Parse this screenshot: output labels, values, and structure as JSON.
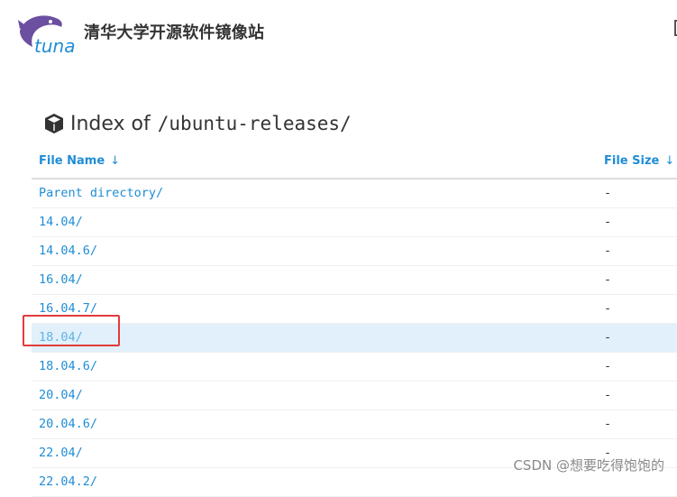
{
  "header": {
    "logo_text": "tuna",
    "site_title": "清华大学开源软件镜像站"
  },
  "index": {
    "prefix": "Index of",
    "path": "/ubuntu-releases/"
  },
  "table": {
    "columns": [
      {
        "label": "File Name",
        "sort_arrow": "↓"
      },
      {
        "label": "File Size",
        "sort_arrow": "↓"
      }
    ],
    "rows": [
      {
        "name": "Parent directory/",
        "size": "-"
      },
      {
        "name": "14.04/",
        "size": "-"
      },
      {
        "name": "14.04.6/",
        "size": "-"
      },
      {
        "name": "16.04/",
        "size": "-"
      },
      {
        "name": "16.04.7/",
        "size": "-"
      },
      {
        "name": "18.04/",
        "size": "-",
        "highlighted": true
      },
      {
        "name": "18.04.6/",
        "size": "-"
      },
      {
        "name": "20.04/",
        "size": "-"
      },
      {
        "name": "20.04.6/",
        "size": "-"
      },
      {
        "name": "22.04/",
        "size": "-"
      },
      {
        "name": "22.04.2/",
        "size": ""
      }
    ]
  },
  "watermark": "CSDN @想要吃得饱饱的",
  "colors": {
    "link": "#1f8dd6",
    "highlight_row": "#e1f0fa",
    "annotation": "#e23b3b",
    "logo_fish": "#6b4fa0",
    "logo_text": "#1f8dd6"
  }
}
